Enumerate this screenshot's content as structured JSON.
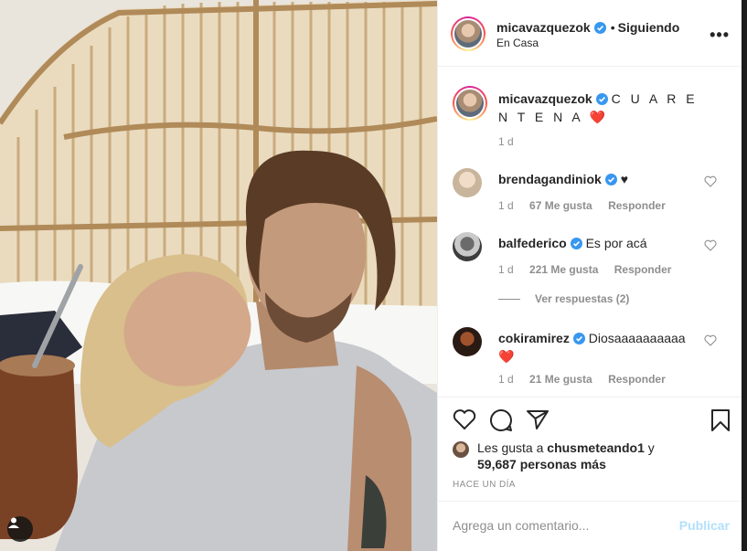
{
  "header": {
    "username": "micavazquezok",
    "separator": "•",
    "follow_status": "Siguiendo",
    "location": "En Casa",
    "more": "•••"
  },
  "caption": {
    "username": "micavazquezok",
    "text": "C U A R E N T E N A ❤️",
    "time": "1 d"
  },
  "comments": [
    {
      "username": "brendagandiniok",
      "verified": true,
      "text": "♥",
      "time": "1 d",
      "likes": "67 Me gusta",
      "reply": "Responder"
    },
    {
      "username": "balfederico",
      "verified": true,
      "text": "Es por acá",
      "time": "1 d",
      "likes": "221 Me gusta",
      "reply": "Responder"
    },
    {
      "username": "cokiramirez",
      "verified": true,
      "text": "Diosaaaaaaaaaa ❤️",
      "time": "1 d",
      "likes": "21 Me gusta",
      "reply": "Responder"
    }
  ],
  "view_replies": "Ver respuestas (2)",
  "likes": {
    "prefix": "Les gusta a",
    "user": "chusmeteando1",
    "conjunction": "y",
    "others": "59,687 personas más"
  },
  "timestamp": "HACE UN DÍA",
  "add_comment": {
    "placeholder": "Agrega un comentario...",
    "post_label": "Publicar"
  },
  "colors": {
    "verified": "#3897f0",
    "link_disabled": "#b2dffc",
    "muted": "#8e8e8e"
  }
}
